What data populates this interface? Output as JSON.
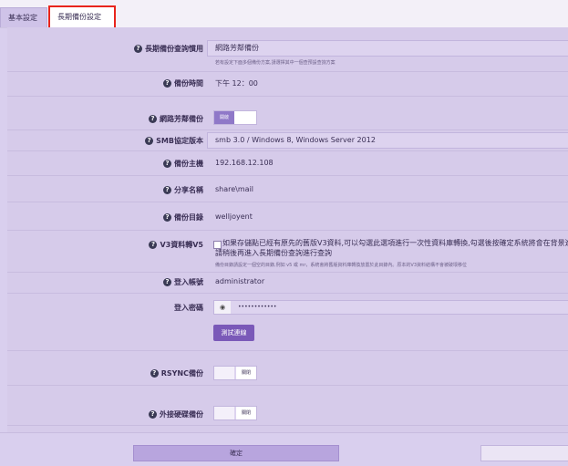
{
  "tabs": [
    {
      "label": "基本設定"
    },
    {
      "label": "長期備份設定"
    }
  ],
  "fields": {
    "query_habit": {
      "label": "長期備份查詢慣用",
      "value": "網路芳鄰備份",
      "hint": "若有設定下面多個備份方案,請選擇其中一個查預設查詢方案"
    },
    "backup_time": {
      "label": "備份時間",
      "value": "下午 12：00"
    },
    "smb_backup": {
      "label": "網路芳鄰備份",
      "toggle_on": "開啟"
    },
    "smb_version": {
      "label": "SMB協定版本",
      "value": "smb 3.0 / Windows 8, Windows Server 2012"
    },
    "backup_host": {
      "label": "備份主機",
      "value": "192.168.12.108"
    },
    "share_name": {
      "label": "分享名稱",
      "value": "share\\mail"
    },
    "backup_dir": {
      "label": "備份目錄",
      "value": "welljoyent"
    },
    "v3_convert": {
      "label": "V3資料轉V5",
      "text_line1": "如果存儲點已經有原先的舊版V3資料,可以勾選此選項進行一次性資料庫轉換,勾選後按確定系統將會在背景進行資料",
      "text_line2": "請稍後再進入長期備份查詢進行查詢",
      "hint": "備份目錄請設定一個空的目錄,例如 v5 或 mr，系統會將舊版資料庫轉換放置於此目錄內。原本的V3資料結構不會被破壞移位"
    },
    "login_account": {
      "label": "登入帳號",
      "value": "administrator"
    },
    "login_password": {
      "label": "登入密碼",
      "value": "••••••••••••"
    },
    "test_button": {
      "label": "測試連線"
    },
    "rsync_backup": {
      "label": "RSYNC備份",
      "toggle_off": "關閉"
    },
    "external_backup": {
      "label": "外接硬碟備份",
      "toggle_off": "關閉"
    }
  },
  "footer": {
    "confirm_label": "確定"
  },
  "icons": {
    "help": "question-circle-icon",
    "eye": "eye-icon"
  },
  "colors": {
    "accent": "#7a59b8",
    "highlight": "#e8241c",
    "panel": "#d6cbea"
  }
}
